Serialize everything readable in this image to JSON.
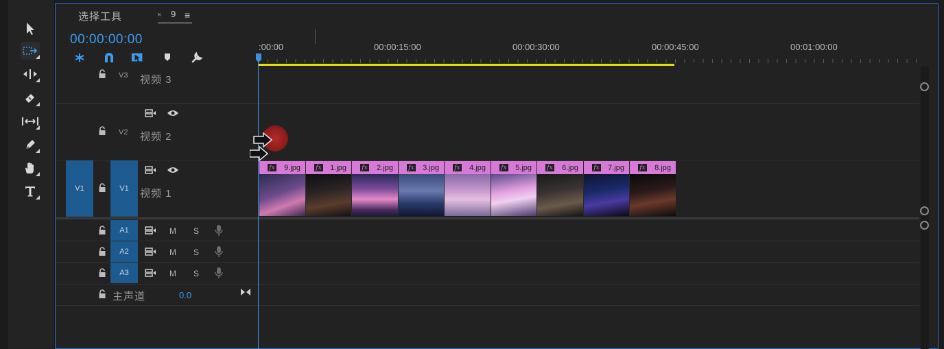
{
  "panel": {
    "tab_title": "选择工具",
    "tab_close": "×",
    "sequence_tab": "9",
    "tab_menu": "≡"
  },
  "timecode": "00:00:00:00",
  "ruler": {
    "labels": [
      ":00:00",
      "00:00:15:00",
      "00:00:30:00",
      "00:00:45:00",
      "00:01:00:00"
    ]
  },
  "tools": [
    "selection-tool",
    "track-select-forward-tool",
    "ripple-edit-tool",
    "razor-tool",
    "slip-tool",
    "pen-tool",
    "hand-tool",
    "type-tool"
  ],
  "timeline_controls": [
    "nest-sequence-icon",
    "snap-icon",
    "linked-selection-icon",
    "add-marker-icon",
    "timeline-settings-icon"
  ],
  "video_tracks": [
    {
      "id": "V3",
      "name": "视频 3"
    },
    {
      "id": "V2",
      "name": "视频 2"
    },
    {
      "id": "V1",
      "source": "V1",
      "name": "视频 1"
    }
  ],
  "audio_tracks": [
    {
      "id": "A1",
      "mute": "M",
      "solo": "S"
    },
    {
      "id": "A2",
      "mute": "M",
      "solo": "S"
    },
    {
      "id": "A3",
      "mute": "M",
      "solo": "S"
    }
  ],
  "master": {
    "name": "主声道",
    "value": "0.0"
  },
  "clips": [
    {
      "fx": "fx",
      "name": "9.jpg"
    },
    {
      "fx": "fx",
      "name": "1.jpg"
    },
    {
      "fx": "fx",
      "name": "2.jpg"
    },
    {
      "fx": "fx",
      "name": "3.jpg"
    },
    {
      "fx": "fx",
      "name": "4.jpg"
    },
    {
      "fx": "fx",
      "name": "5.jpg"
    },
    {
      "fx": "fx",
      "name": "6.jpg"
    },
    {
      "fx": "fx",
      "name": "7.jpg"
    },
    {
      "fx": "fx",
      "name": "8.jpg"
    }
  ],
  "colors": {
    "accent": "#3d9cf2",
    "clip_header": "#d77ad7",
    "work_area": "#e8e000",
    "track_target": "#1d5a8f"
  }
}
